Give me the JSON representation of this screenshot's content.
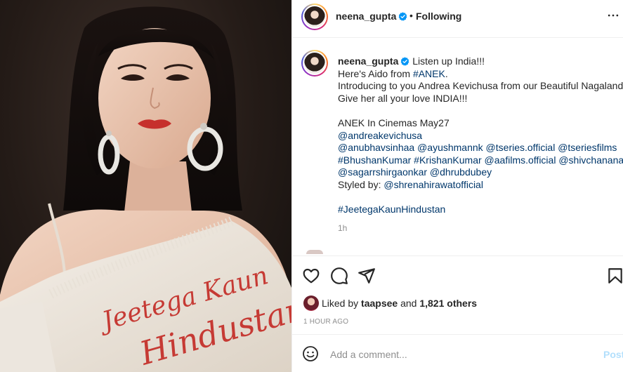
{
  "post": {
    "author": "neena_gupta",
    "follow_separator": "•",
    "follow_status": "Following",
    "image_print_lines": [
      "Jeetega Kaun",
      "Hindustan"
    ]
  },
  "caption": {
    "author": "neena_gupta",
    "first_line": "Listen up India!!!",
    "line2_prefix": "Here's Aido from ",
    "line2_tag": "#ANEK",
    "line2_suffix": ".",
    "line3": "Introducing to you Andrea Kevichusa from our Beautiful Nagaland.",
    "line4": "Give her all your love INDIA!!!",
    "line5": "ANEK In Cinemas May27",
    "line6": "@andreakevichusa",
    "line7": "@anubhavsinhaa @ayushmannk @tseries.official @tseriesfilms",
    "line8": "#BhushanKumar #KrishanKumar @aafilms.official @shivchanana",
    "line9": "@sagarrshirgaonkar @dhrubdubey",
    "line10_prefix": "Styled by: ",
    "line10_link": "@shrenahirawatofficial",
    "line11": "#JeetegaKaunHindustan",
    "time": "1h"
  },
  "actions": {
    "icons": [
      "heart-icon",
      "comment-icon",
      "share-icon",
      "bookmark-icon"
    ]
  },
  "likes": {
    "prefix": "Liked by ",
    "user": "taapsee",
    "middle": " and ",
    "count": "1,821 others"
  },
  "timestamp": "1 HOUR AGO",
  "comment_box": {
    "placeholder": "Add a comment...",
    "post_label": "Post"
  },
  "colors": {
    "link": "#00376b",
    "verified": "#0095f6",
    "post_disabled": "#b2dffc",
    "muted": "#8e8e8e"
  }
}
